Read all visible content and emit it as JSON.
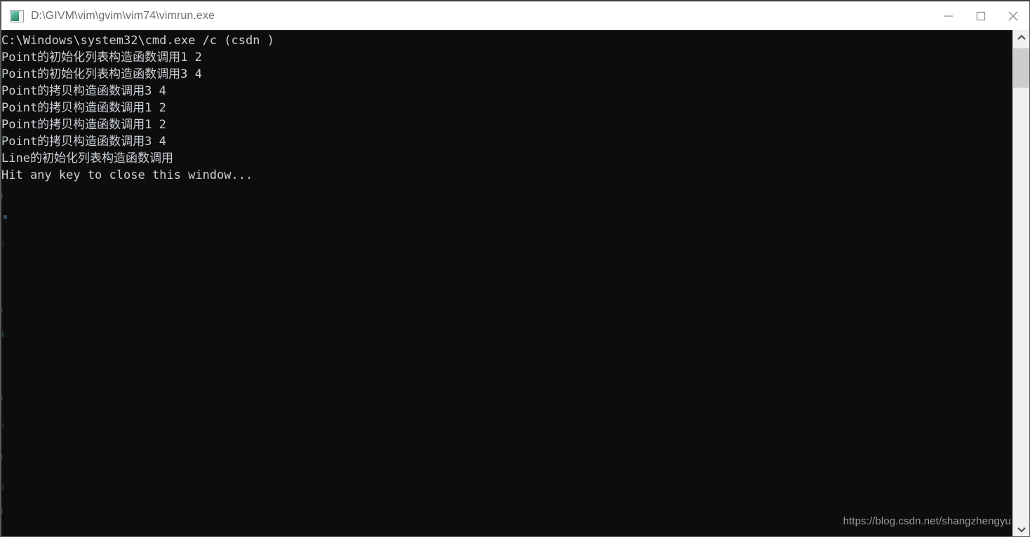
{
  "window": {
    "title": "D:\\GIVM\\vim\\gvim\\vim74\\vimrun.exe",
    "icon": "vimrun-app-icon",
    "controls": {
      "minimize": "minimize-icon",
      "maximize": "maximize-icon",
      "close": "close-icon"
    }
  },
  "console": {
    "background_color": "#0d0d0d",
    "text_color": "#cdd2d8",
    "lines": [
      "C:\\Windows\\system32\\cmd.exe /c (csdn )",
      "Point的初始化列表构造函数调用1 2",
      "Point的初始化列表构造函数调用3 4",
      "Point的拷贝构造函数调用3 4",
      "Point的拷贝构造函数调用1 2",
      "Point的拷贝构造函数调用1 2",
      "Point的拷贝构造函数调用3 4",
      "Line的初始化列表构造函数调用",
      "Hit any key to close this window..."
    ]
  },
  "watermark": {
    "text": "https://blog.csdn.net/shangzhengyu"
  },
  "scrollbar": {
    "up_arrow": "chevron-up-icon",
    "down_arrow": "chevron-down-icon",
    "thumb_color": "#cdcdcd",
    "track_color": "#f0f0f0"
  }
}
